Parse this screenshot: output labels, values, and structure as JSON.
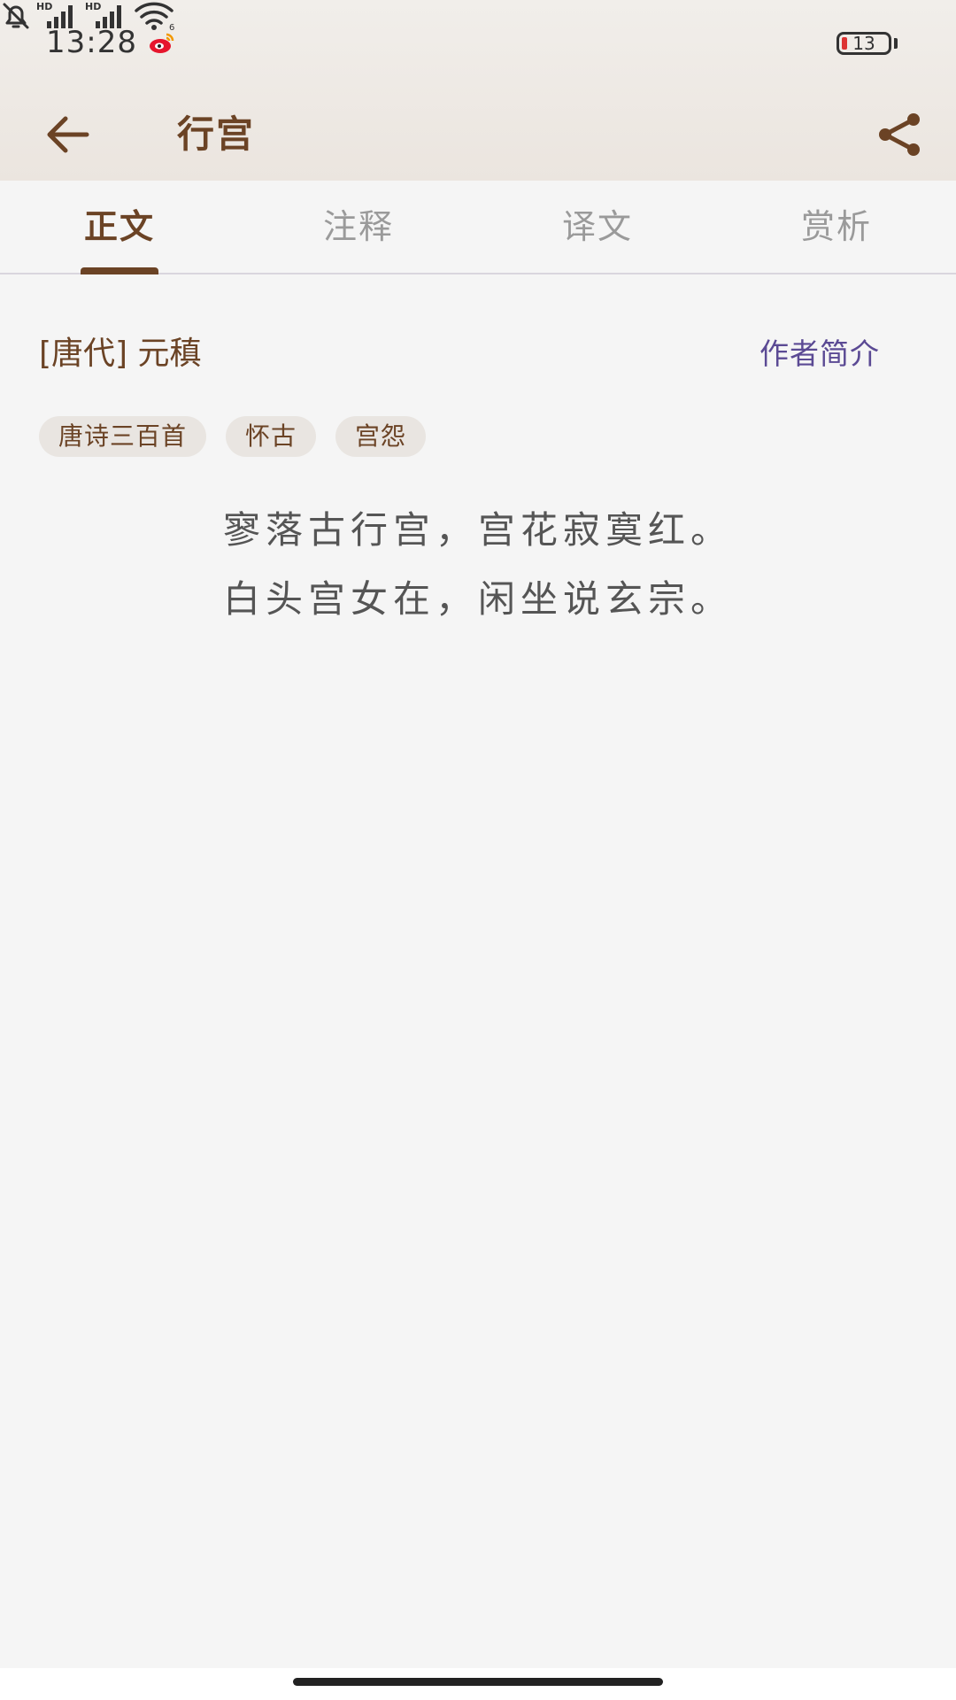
{
  "status_bar": {
    "time": "13:28",
    "battery_level": "13",
    "icons": [
      "weibo-icon",
      "bell-off-icon",
      "hd-signal-icon",
      "hd-signal-icon",
      "wifi-icon",
      "battery-icon"
    ]
  },
  "appbar": {
    "title": "行宫",
    "back_icon": "arrow-left-icon",
    "share_icon": "share-icon"
  },
  "tabs": [
    {
      "label": "正文",
      "active": true
    },
    {
      "label": "注释",
      "active": false
    },
    {
      "label": "译文",
      "active": false
    },
    {
      "label": "赏析",
      "active": false
    }
  ],
  "meta": {
    "dynasty_author": "[唐代] 元稹",
    "author_intro_link": "作者简介"
  },
  "tags": [
    "唐诗三百首",
    "怀古",
    "宫怨"
  ],
  "poem": {
    "lines": [
      "寥落古行宫，宫花寂寞红。",
      "白头宫女在，闲坐说玄宗。"
    ]
  },
  "colors": {
    "brand_brown": "#6b4325",
    "link_purple": "#5b4a94",
    "tag_bg": "#e9e5e1",
    "page_bg": "#f5f5f5"
  }
}
